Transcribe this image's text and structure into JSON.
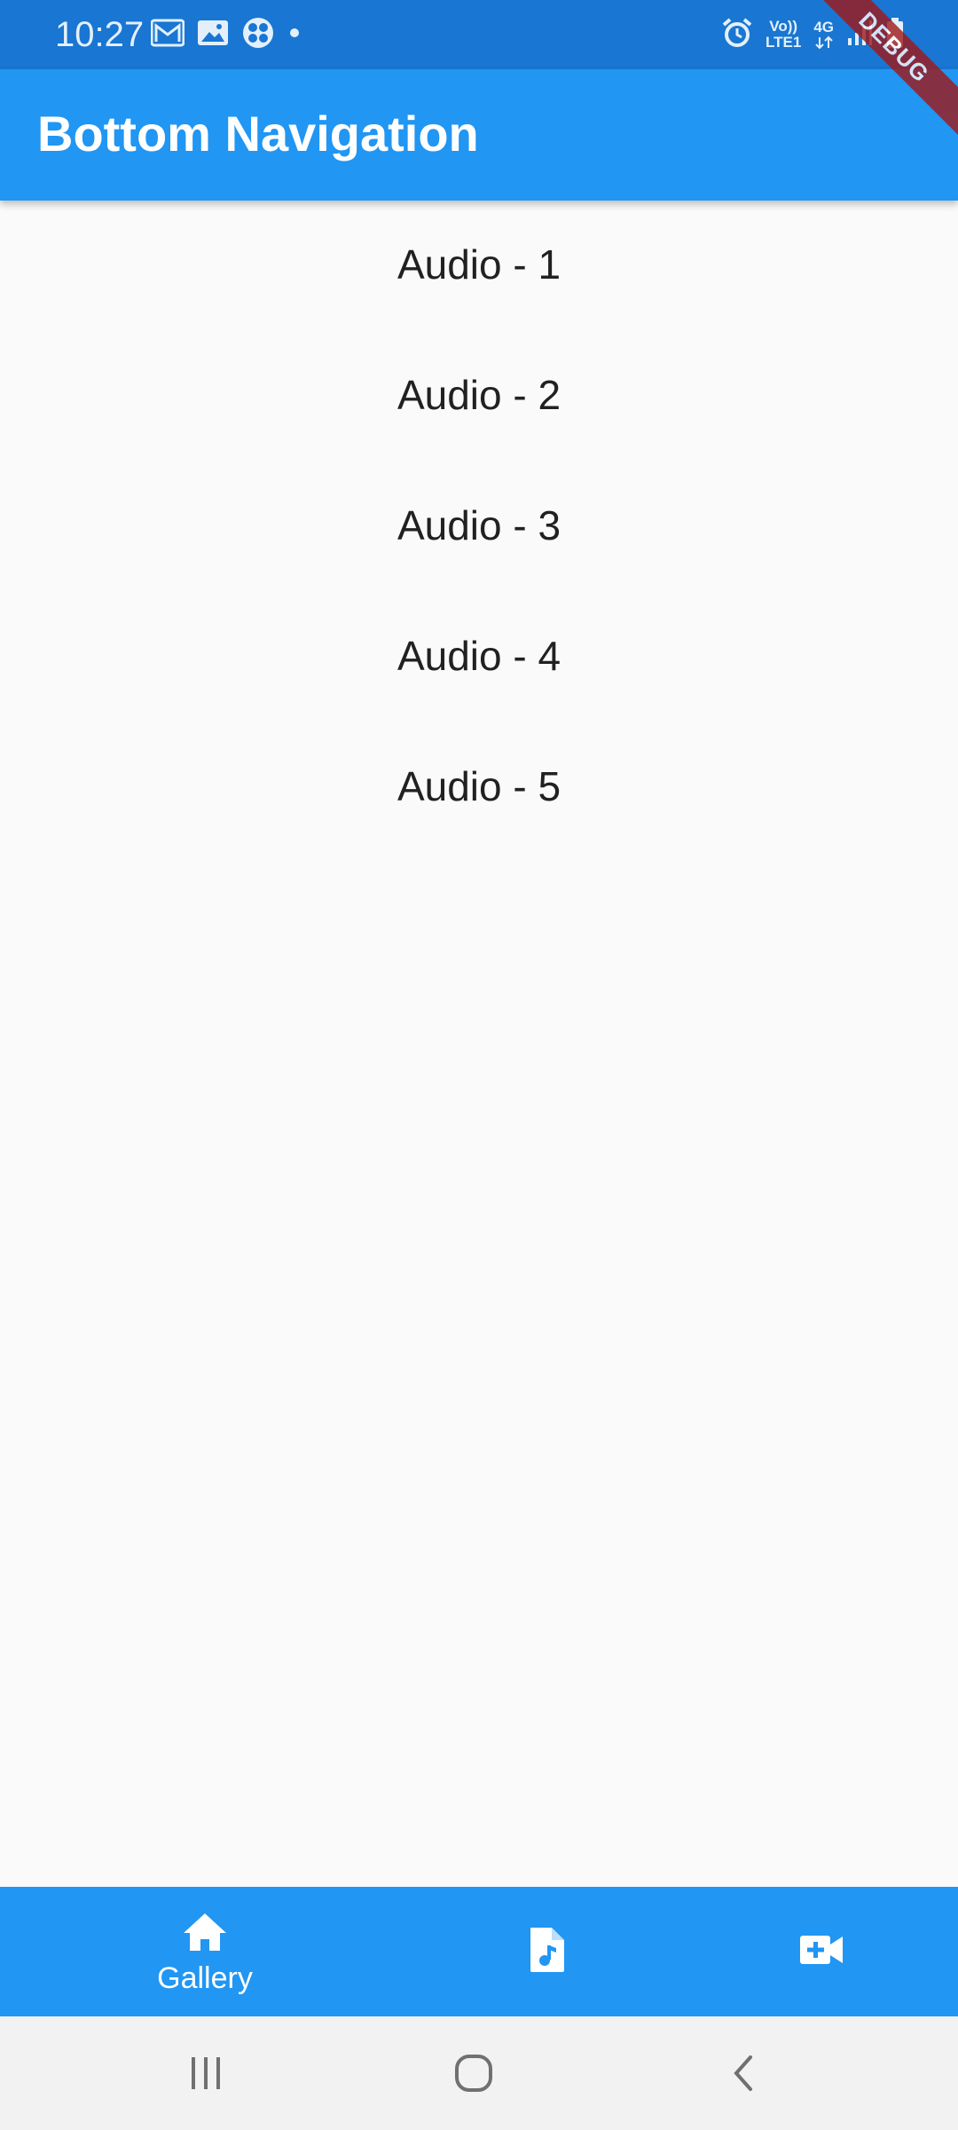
{
  "status_bar": {
    "time": "10:27",
    "left_icons": [
      "gmail-icon",
      "image-icon",
      "fan-icon",
      "dot-icon"
    ],
    "right_icons": [
      "alarm-icon",
      "volte-icon",
      "4g-icon",
      "signal-icon",
      "battery-icon"
    ],
    "volte_top": "Vo))",
    "volte_bottom": "LTE1",
    "network_label": "4G"
  },
  "debug_banner": "DEBUG",
  "app_bar": {
    "title": "Bottom Navigation",
    "background": "#2196f3"
  },
  "content": {
    "items": [
      {
        "label": "Audio - 1"
      },
      {
        "label": "Audio - 2"
      },
      {
        "label": "Audio - 3"
      },
      {
        "label": "Audio - 4"
      },
      {
        "label": "Audio - 5"
      }
    ]
  },
  "bottom_nav": {
    "items": [
      {
        "icon": "home-icon",
        "label": "Gallery",
        "selected": true
      },
      {
        "icon": "audio-file-icon",
        "label": "",
        "selected": false
      },
      {
        "icon": "video-call-icon",
        "label": "",
        "selected": false
      }
    ]
  },
  "system_nav": {
    "buttons": [
      "recent-apps-icon",
      "home-circle-icon",
      "back-icon"
    ]
  }
}
